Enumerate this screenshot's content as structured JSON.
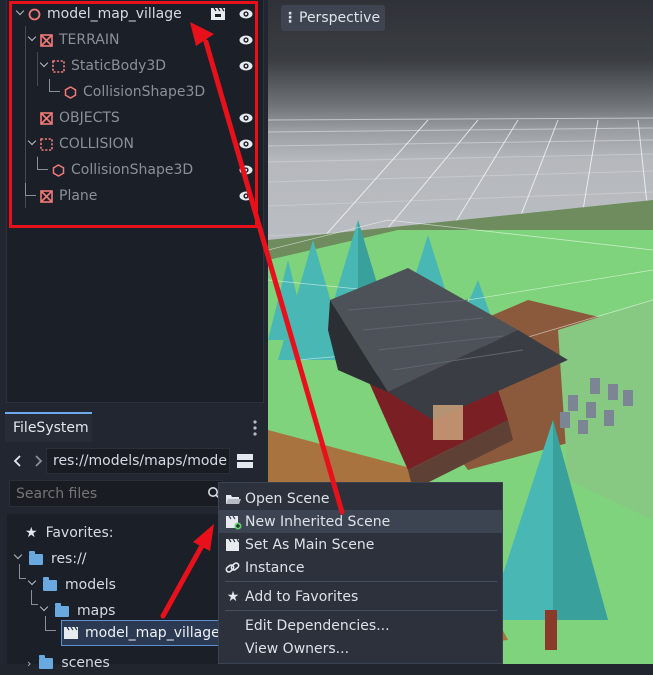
{
  "scene_tree": {
    "nodes": [
      {
        "label": "model_map_village",
        "dim": false
      },
      {
        "label": "TERRAIN",
        "dim": true
      },
      {
        "label": "StaticBody3D",
        "dim": true
      },
      {
        "label": "CollisionShape3D",
        "dim": true
      },
      {
        "label": "OBJECTS",
        "dim": true
      },
      {
        "label": "COLLISION",
        "dim": true
      },
      {
        "label": "CollisionShape3D",
        "dim": true
      },
      {
        "label": "Plane",
        "dim": true
      }
    ],
    "highlight_color": "#e8111b"
  },
  "viewport": {
    "perspective_label": "Perspective"
  },
  "filesystem": {
    "tab_label": "FileSystem",
    "path": "res://models/maps/mode",
    "search_placeholder": "Search files",
    "tree": {
      "favorites": "Favorites:",
      "res": "res://",
      "models": "models",
      "maps": "maps",
      "file": "model_map_village.g",
      "scenes": "scenes"
    }
  },
  "context_menu": {
    "items": [
      {
        "label": "Open Scene",
        "icon": "folder-open-icon"
      },
      {
        "label": "New Inherited Scene",
        "icon": "inherited-scene-icon"
      },
      {
        "label": "Set As Main Scene",
        "icon": "clapper-icon"
      },
      {
        "label": "Instance",
        "icon": "link-icon"
      },
      {
        "label": "Add to Favorites",
        "icon": "star-icon"
      },
      {
        "label": "Edit Dependencies...",
        "icon": ""
      },
      {
        "label": "View Owners...",
        "icon": ""
      }
    ],
    "highlighted_index": 1
  },
  "colors": {
    "accent_blue": "#6ea9ec",
    "folder_blue": "#6aa9e0",
    "node_icon_red": "#f07a7a",
    "annotation_red": "#e8111b",
    "grass_green": "#7fd37c",
    "tree_teal": "#49b8b4"
  }
}
